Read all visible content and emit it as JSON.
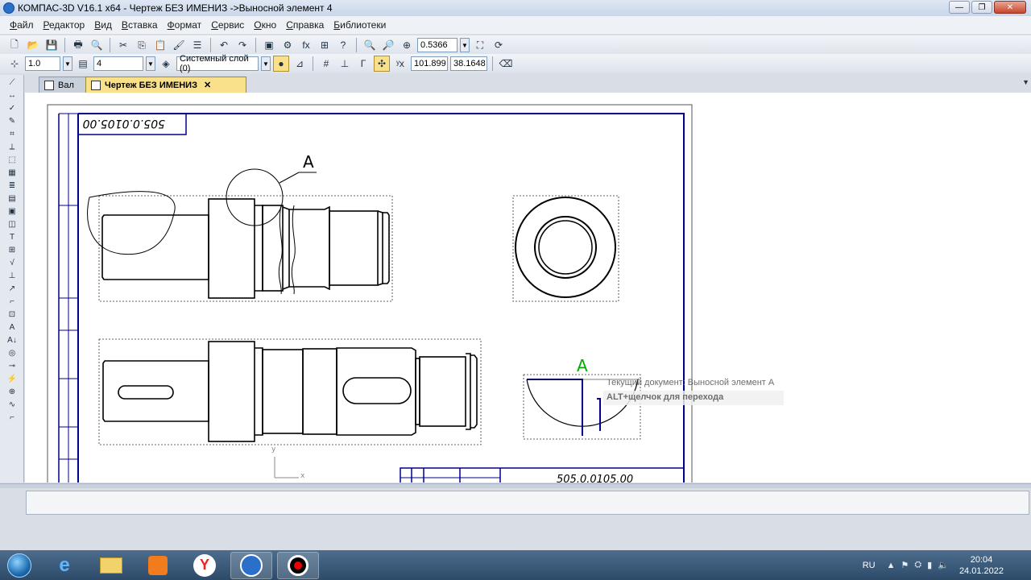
{
  "window": {
    "title": "КОМПАС-3D V16.1 x64 - Чертеж БЕЗ ИМЕНИЗ ->Выносной элемент 4",
    "buttons": {
      "minimize": "—",
      "maximize": "❐",
      "close": "✕"
    }
  },
  "menu": [
    "Файл",
    "Редактор",
    "Вид",
    "Вставка",
    "Формат",
    "Сервис",
    "Окно",
    "Справка",
    "Библиотеки"
  ],
  "toolbar1": {
    "zoom_value": "0.5366"
  },
  "toolbar2": {
    "step_value": "1.0",
    "style_value": "4",
    "layer_value": "Системный слой (0)",
    "coord_x": "101.899",
    "coord_y": "38.1648"
  },
  "tabs": [
    {
      "label": "Вал",
      "active": false
    },
    {
      "label": "Чертеж БЕЗ ИМЕНИЗ",
      "active": true,
      "close": "✕"
    }
  ],
  "drawing": {
    "stamp_code_top": "505.0.0105.00",
    "stamp_code_bottom": "505.0.0105.00",
    "view_label_a": "А",
    "detail_label_a": "А",
    "axis_y": "y",
    "axis_x": "x",
    "colors": {
      "frame": "#00008b",
      "line": "#000000",
      "detail_label": "#00aa00"
    }
  },
  "tooltip": {
    "document": "Текущий документ: Выносной элемент А",
    "hint": "ALT+щелчок для перехода"
  },
  "taskbar": {
    "apps": [
      "internet-explorer",
      "explorer",
      "media-player",
      "yandex-browser",
      "kompas",
      "recorder"
    ],
    "yandex_label": "Y",
    "language": "RU",
    "time": "20:04",
    "date": "24.01.2022"
  }
}
